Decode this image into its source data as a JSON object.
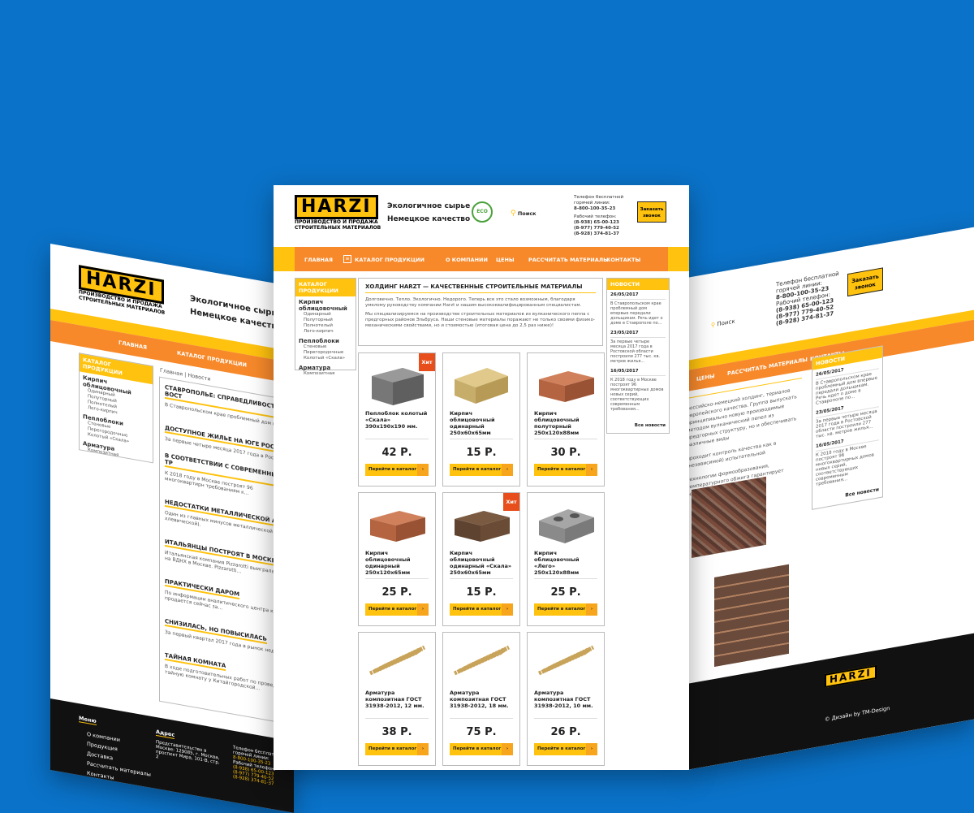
{
  "brand": {
    "logo": "HARZI",
    "tagline1": "ПРОИЗВОДСТВО И ПРОДАЖА",
    "tagline2": "СТРОИТЕЛЬНЫХ МАТЕРИАЛОВ"
  },
  "header": {
    "eco1": "Экологичное сырье",
    "eco2": "Немецкое качество",
    "eco_badge": "ECO",
    "search": "Поиск",
    "hotline_label1": "Телефон бесплатной",
    "hotline_label2": "горячей линии:",
    "hotline": "8-800-100-35-23",
    "work_label": "Рабочий телефон:",
    "phone1": "(8-938) 65-00-123",
    "phone2": "(8-977) 779-40-52",
    "phone3": "(8-928) 374-81-37",
    "call_btn1": "Заказать",
    "call_btn2": "звонок"
  },
  "nav": {
    "home": "ГЛАВНАЯ",
    "catalog": "КАТАЛОГ ПРОДУКЦИИ",
    "about": "О КОМПАНИИ",
    "prices": "ЦЕНЫ",
    "calc": "РАССЧИТАТЬ МАТЕРИАЛЫ",
    "contacts": "КОНТАКТЫ"
  },
  "catalog": {
    "title": "КАТАЛОГ ПРОДУКЦИИ",
    "groups": [
      {
        "name": "Кирпич облицовочный",
        "items": [
          "Одинарный",
          "Полуторный",
          "Полнотелый",
          "Лего-кирпич"
        ]
      },
      {
        "name": "Пеплоблоки",
        "items": [
          "Стеновые",
          "Перегородочные",
          "Колотый «Скала»"
        ]
      },
      {
        "name": "Арматура",
        "items": [
          "Композитная"
        ]
      }
    ]
  },
  "about": {
    "title": "ХОЛДИНГ HARZT — КАЧЕСТВЕННЫЕ СТРОИТЕЛЬНЫЕ МАТЕРИАЛЫ",
    "p1": "Долговечно. Тепло. Экологично. Недорого. Теперь все это стало возможным, благодаря умелому руководству компании Harzt и нашим высококвалифицированным специалистам.",
    "p2": "Мы специализируемся на производстве строительных материалов из вулканического пепла с предгорных районов Эльбруса. Наши стеновые материалы поражают не только своими физико-механическими свойствами, но и стоимостью (итоговая цена до 2,5 раз ниже)!"
  },
  "products": [
    {
      "name": "Пеплоблок колотый «Скала» 390х190х190 мм.",
      "price": "42 Р.",
      "button": "Перейти в каталог",
      "badge": "Хит"
    },
    {
      "name": "Кирпич облицовочный одинарный 250х60х65мм",
      "price": "15 Р.",
      "button": "Перейти в каталог",
      "badge": ""
    },
    {
      "name": "Кирпич облицовочный полуторный 250х120х88мм",
      "price": "30 Р.",
      "button": "Перейти в каталог",
      "badge": ""
    },
    {
      "name": "Кирпич облицовочный одинарный 250х120х65мм",
      "price": "25 Р.",
      "button": "Перейти в каталог",
      "badge": ""
    },
    {
      "name": "Кирпич облицовочный одинарный «Скала» 250х60х65мм",
      "price": "15 Р.",
      "button": "Перейти в каталог",
      "badge": "Хит"
    },
    {
      "name": "Кирпич облицовочный «Лего» 250х120х88мм",
      "price": "25 Р.",
      "button": "Перейти в каталог",
      "badge": ""
    },
    {
      "name": "Арматура композитная ГОСТ 31938-2012, 12 мм.",
      "price": "38 Р.",
      "button": "Перейти в каталог",
      "badge": ""
    },
    {
      "name": "Арматура композитная ГОСТ 31938-2012, 18 мм.",
      "price": "75 Р.",
      "button": "Перейти в каталог",
      "badge": ""
    },
    {
      "name": "Арматура композитная ГОСТ 31938-2012, 10 мм.",
      "price": "26 Р.",
      "button": "Перейти в каталог",
      "badge": ""
    }
  ],
  "news": {
    "title": "НОВОСТИ",
    "items": [
      {
        "date": "26/05/2017",
        "text": "В Ставропольском крае проблемный дом впервые передали дольщикам. Речь идет о доме в Ставрополе по..."
      },
      {
        "date": "23/05/2017",
        "text": "За первые четыре месяца 2017 года в Ростовской области построили 277 тыс. кв. метров жилья..."
      },
      {
        "date": "16/05/2017",
        "text": "К 2018 году в Москве построят 96 многоквартирных домов новых серий, соответствующих современным требования..."
      }
    ],
    "all": "Все новости"
  },
  "left_page": {
    "breadcrumb": "Главная | Новости",
    "articles": [
      {
        "title": "СТАВРОПОЛЬЕ: СПРАВЕДЛИВОСТЬ ВОСТ",
        "text": "В Ставропольском крае проблемный дом впер"
      },
      {
        "title": "ДОСТУПНОЕ ЖИЛЬЕ НА ЮГЕ РОССИИ",
        "text": "За первые четыре месяца 2017 года в Ростовск"
      },
      {
        "title": "В СООТВЕТСТВИИ С СОВРЕМЕННЫМИ ТР",
        "text": "К 2018 году в Москве построят 96 многоквартирн требованиям к..."
      },
      {
        "title": "НЕДОСТАТКИ МЕТАЛЛИЧЕСКОЙ АРМА",
        "text": "Один из главных минусов металлической арм хлевической)."
      },
      {
        "title": "ИТАЛЬЯНЦЫ ПОСТРОЯТ В МОСКВЕ ДИ",
        "text": "Итальянская компания Pizzarotti выиграла кон на ВДНХ в Москве. Pizzarotti..."
      },
      {
        "title": "ПРАКТИЧЕСКИ ДАРОМ",
        "text": "По информации аналитического центра комп продается сейчас за..."
      },
      {
        "title": "СНИЗИЛАСЬ, НО ПОВЫСИЛАСЬ",
        "text": "За первый квартал 2017 года в рынок недвиж"
      },
      {
        "title": "ТАЙНАЯ КОМНАТА",
        "text": "В ходе подготовительных работ по проведени тайную комнату у Китайгородской..."
      }
    ],
    "footer": {
      "menu_title": "Меню",
      "menu": [
        "О компании",
        "Продукция",
        "Доставка",
        "Рассчитать материалы",
        "Контакты"
      ],
      "address_title": "Адрес",
      "address": "Представительство в Москве: 129085, г. Москва, проспект Мира, 101-В, стр. 2"
    }
  },
  "right_page": {
    "text1": "российско-немецкий холдинг, териалов европейского качества. Группа выпускать принципиально новую производимые методом вулканический пепел из предгорных структуру, но и обеспечивать различные виды",
    "text2": "проходит контроль качества как в (независимой) испытательной",
    "text3": "технологии формообразования, температурного обжига гарантирует особую характеристики.",
    "credit": "© Дизайн by TM-Design"
  },
  "colors": {
    "blue": "#0a72c8",
    "yellow": "#ffc20e",
    "orange": "#f7892b",
    "red": "#e84e1b"
  }
}
